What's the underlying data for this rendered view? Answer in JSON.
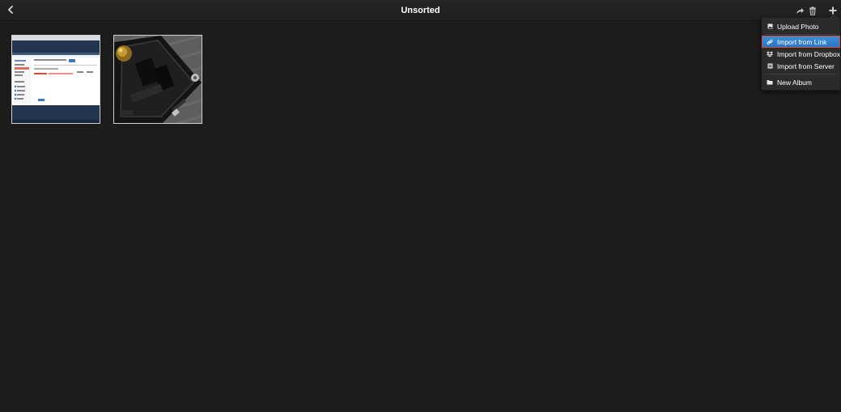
{
  "header": {
    "title": "Unsorted",
    "back_icon": "chevron-left-icon",
    "actions": [
      {
        "name": "share-icon"
      },
      {
        "name": "trash-icon"
      },
      {
        "name": "plus-icon"
      }
    ]
  },
  "photos": [
    {
      "name": "photo-screenshot"
    },
    {
      "name": "photo-device"
    }
  ],
  "menu": {
    "items": [
      {
        "label": "Upload Photo",
        "icon": "image-icon"
      },
      {
        "label": "Import from Link",
        "icon": "link-icon",
        "active": true
      },
      {
        "label": "Import from Dropbox",
        "icon": "dropbox-icon"
      },
      {
        "label": "Import from Server",
        "icon": "server-icon"
      },
      {
        "label": "New Album",
        "icon": "folder-icon"
      }
    ]
  },
  "colors": {
    "background": "#1c1c1c",
    "menu_active": "#2a7fd4",
    "highlight_border": "#e0433a"
  }
}
